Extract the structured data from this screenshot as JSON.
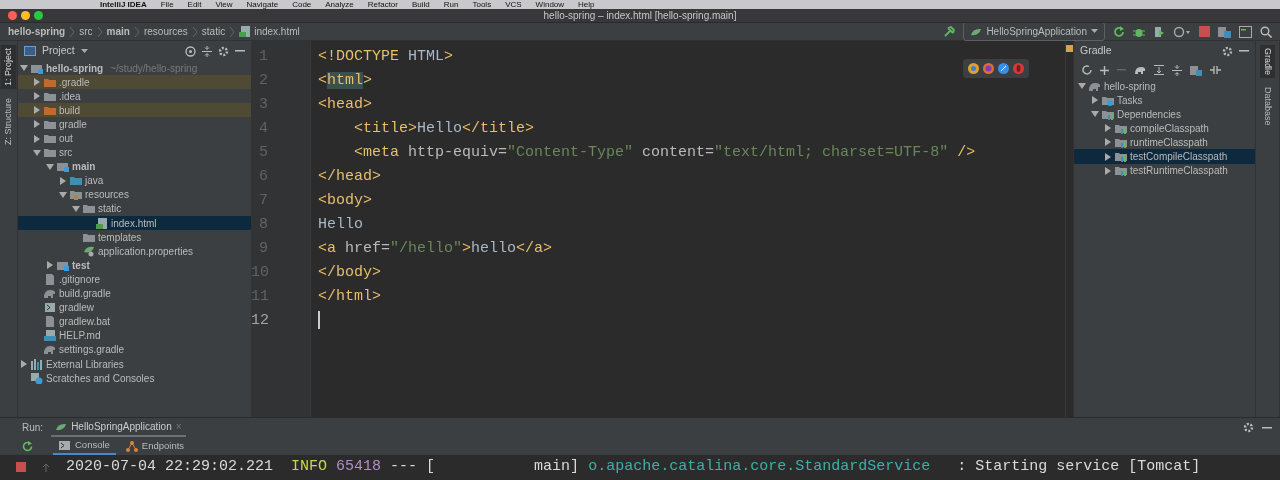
{
  "menu_bar": {
    "app": "IntelliJ IDEA",
    "items": [
      "File",
      "Edit",
      "View",
      "Navigate",
      "Code",
      "Analyze",
      "Refactor",
      "Build",
      "Run",
      "Tools",
      "VCS",
      "Window",
      "Help"
    ]
  },
  "window": {
    "title": "hello-spring – index.html [hello-spring.main]"
  },
  "breadcrumbs": [
    {
      "label": "hello-spring",
      "bold": true,
      "kind": "folder"
    },
    {
      "label": "src",
      "kind": "folder"
    },
    {
      "label": "main",
      "bold": true,
      "kind": "folder"
    },
    {
      "label": "resources",
      "kind": "folder"
    },
    {
      "label": "static",
      "kind": "folder"
    },
    {
      "label": "index.html",
      "kind": "html"
    }
  ],
  "run_config": {
    "label": "HelloSpringApplication"
  },
  "left_stripe": [
    {
      "label": "1: Project",
      "selected": true
    },
    {
      "label": "Z: Structure",
      "selected": false
    }
  ],
  "project_panel": {
    "title": "Project",
    "tree": [
      {
        "label": "hello-spring",
        "hint": "~/study/hello-spring",
        "bold": true,
        "kind": "module",
        "expanded": true,
        "selected": false,
        "children": [
          {
            "label": ".gradle",
            "kind": "excluded",
            "excluded": true,
            "expanded": false,
            "selected": false
          },
          {
            "label": ".idea",
            "kind": "folder",
            "expanded": false,
            "selected": false
          },
          {
            "label": "build",
            "kind": "excluded",
            "excluded": true,
            "expanded": false,
            "selected": false
          },
          {
            "label": "gradle",
            "kind": "folder",
            "expanded": false,
            "selected": false
          },
          {
            "label": "out",
            "kind": "folder",
            "expanded": false,
            "selected": false
          },
          {
            "label": "src",
            "kind": "folder",
            "expanded": true,
            "selected": false,
            "children": [
              {
                "label": "main",
                "bold": true,
                "kind": "module",
                "expanded": true,
                "selected": false,
                "children": [
                  {
                    "label": "java",
                    "kind": "source",
                    "expanded": false,
                    "selected": false
                  },
                  {
                    "label": "resources",
                    "kind": "resources",
                    "expanded": true,
                    "selected": false,
                    "children": [
                      {
                        "label": "static",
                        "kind": "folder",
                        "expanded": true,
                        "selected": false,
                        "children": [
                          {
                            "label": "index.html",
                            "kind": "html",
                            "selected": true
                          }
                        ]
                      },
                      {
                        "label": "templates",
                        "kind": "folder",
                        "selected": false
                      },
                      {
                        "label": "application.properties",
                        "kind": "properties",
                        "selected": false
                      }
                    ]
                  }
                ]
              },
              {
                "label": "test",
                "bold": true,
                "kind": "module",
                "expanded": false,
                "selected": false
              }
            ]
          },
          {
            "label": ".gitignore",
            "kind": "file",
            "selected": false
          },
          {
            "label": "build.gradle",
            "kind": "gradle",
            "selected": false
          },
          {
            "label": "gradlew",
            "kind": "script",
            "selected": false
          },
          {
            "label": "gradlew.bat",
            "kind": "file",
            "selected": false
          },
          {
            "label": "HELP.md",
            "kind": "markdown",
            "selected": false
          },
          {
            "label": "settings.gradle",
            "kind": "gradle",
            "selected": false
          }
        ]
      },
      {
        "label": "External Libraries",
        "kind": "libraries",
        "expanded": false,
        "selected": false
      },
      {
        "label": "Scratches and Consoles",
        "kind": "scratches",
        "selected": false
      }
    ]
  },
  "editor": {
    "lines": [
      {
        "number": "1",
        "tokens": [
          {
            "kind": "tag",
            "text": "<!DOCTYPE "
          },
          {
            "kind": "text",
            "text": "HTML"
          },
          {
            "kind": "tag",
            "text": ">"
          }
        ]
      },
      {
        "number": "2",
        "tokens": [
          {
            "kind": "tag",
            "text": "<"
          },
          {
            "kind": "match",
            "text": "html"
          },
          {
            "kind": "tag",
            "text": ">"
          }
        ]
      },
      {
        "number": "3",
        "tokens": [
          {
            "kind": "tag",
            "text": "<head>"
          }
        ]
      },
      {
        "number": "4",
        "indented": true,
        "tokens": [
          {
            "kind": "tag",
            "text": "<title>"
          },
          {
            "kind": "text",
            "text": "Hello"
          },
          {
            "kind": "tag",
            "text": "</title>"
          }
        ]
      },
      {
        "number": "5",
        "indented": true,
        "tokens": [
          {
            "kind": "tag",
            "text": "<meta "
          },
          {
            "kind": "attr",
            "text": "http-equiv="
          },
          {
            "kind": "value",
            "text": "\"Content-Type\""
          },
          {
            "kind": "attr",
            "text": " content="
          },
          {
            "kind": "value",
            "text": "\"text/html; charset=UTF-8\""
          },
          {
            "kind": "tag",
            "text": " />"
          }
        ]
      },
      {
        "number": "6",
        "tokens": [
          {
            "kind": "tag",
            "text": "</head>"
          }
        ]
      },
      {
        "number": "7",
        "tokens": [
          {
            "kind": "tag",
            "text": "<body>"
          }
        ]
      },
      {
        "number": "8",
        "tokens": [
          {
            "kind": "text",
            "text": "Hello"
          }
        ]
      },
      {
        "number": "9",
        "tokens": [
          {
            "kind": "tag",
            "text": "<a "
          },
          {
            "kind": "attr",
            "text": "href="
          },
          {
            "kind": "value",
            "text": "\"/hello\""
          },
          {
            "kind": "tag",
            "text": ">"
          },
          {
            "kind": "text",
            "text": "hello"
          },
          {
            "kind": "tag",
            "text": "</a>"
          }
        ]
      },
      {
        "number": "10",
        "tokens": [
          {
            "kind": "tag",
            "text": "</body>"
          }
        ]
      },
      {
        "number": "11",
        "tokens": [
          {
            "kind": "tag",
            "text": "</html>"
          }
        ]
      },
      {
        "number": "12",
        "current": true
      }
    ]
  },
  "gradle_panel": {
    "title": "Gradle",
    "tree": [
      {
        "label": "hello-spring",
        "kind": "gradle",
        "expanded": true,
        "selected": false,
        "children": [
          {
            "label": "Tasks",
            "kind": "tasks",
            "expanded": false,
            "selected": false
          },
          {
            "label": "Dependencies",
            "kind": "deps",
            "expanded": true,
            "selected": false,
            "children": [
              {
                "label": "compileClasspath",
                "kind": "deps",
                "expanded": false,
                "selected": false
              },
              {
                "label": "runtimeClasspath",
                "kind": "deps",
                "expanded": false,
                "selected": false
              },
              {
                "label": "testCompileClasspath",
                "kind": "deps",
                "expanded": false,
                "selected": true
              },
              {
                "label": "testRuntimeClasspath",
                "kind": "deps",
                "expanded": false,
                "selected": false
              }
            ]
          }
        ]
      }
    ]
  },
  "right_stripe": [
    {
      "label": "Gradle",
      "selected": true
    },
    {
      "label": "Database",
      "selected": false
    }
  ],
  "run_panel": {
    "label": "Run:",
    "tab": {
      "label": "HelloSpringApplication",
      "close": "×"
    },
    "subtabs": [
      {
        "label": "Console",
        "kind": "console",
        "selected": true
      },
      {
        "label": "Endpoints",
        "kind": "endpoints",
        "selected": false
      }
    ],
    "log": [
      {
        "kind": "date",
        "text": "2020-07-04 22:29:02.221  "
      },
      {
        "kind": "level",
        "text": "INFO"
      },
      {
        "kind": "pid",
        "text": " 65418"
      },
      {
        "kind": "plain",
        "text": " --- [           main] "
      },
      {
        "kind": "logger",
        "text": "o.apache.catalina.core.StandardService"
      },
      {
        "kind": "plain",
        "text": "   : Starting service [Tomcat]"
      }
    ]
  }
}
